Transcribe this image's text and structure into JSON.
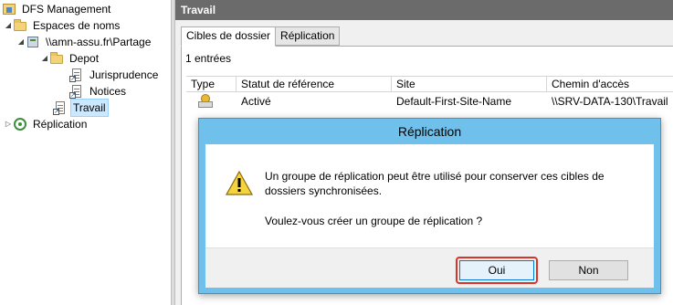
{
  "tree": {
    "root": "DFS Management",
    "namespaces": "Espaces de noms",
    "namespace_path": "\\\\amn-assu.fr\\Partage",
    "depot": "Depot",
    "jurisprudence": "Jurisprudence",
    "notices": "Notices",
    "travail": "Travail",
    "replication": "Réplication"
  },
  "right_pane": {
    "header": "Travail",
    "tabs": [
      "Cibles de dossier",
      "Réplication"
    ],
    "entries_count": "1 entrées",
    "columns": [
      "Type",
      "Statut de référence",
      "Site",
      "Chemin d'accès"
    ],
    "rows": [
      {
        "type_icon": "folder-target-icon",
        "status": "Activé",
        "site": "Default-First-Site-Name",
        "path": "\\\\SRV-DATA-130\\Travail"
      }
    ]
  },
  "dialog": {
    "title": "Réplication",
    "message_line": "Un groupe de réplication peut être utilisé pour conserver ces cibles de dossiers synchronisées.",
    "question": "Voulez-vous créer un groupe de réplication ?",
    "yes_label": "Oui",
    "no_label": "Non",
    "icon": "warning-icon"
  },
  "colors": {
    "dialog_title_bar": "#6fc0ea",
    "header_bar": "#6b6b6b",
    "highlight_border": "#d9342b",
    "selection": "#cce8ff"
  }
}
